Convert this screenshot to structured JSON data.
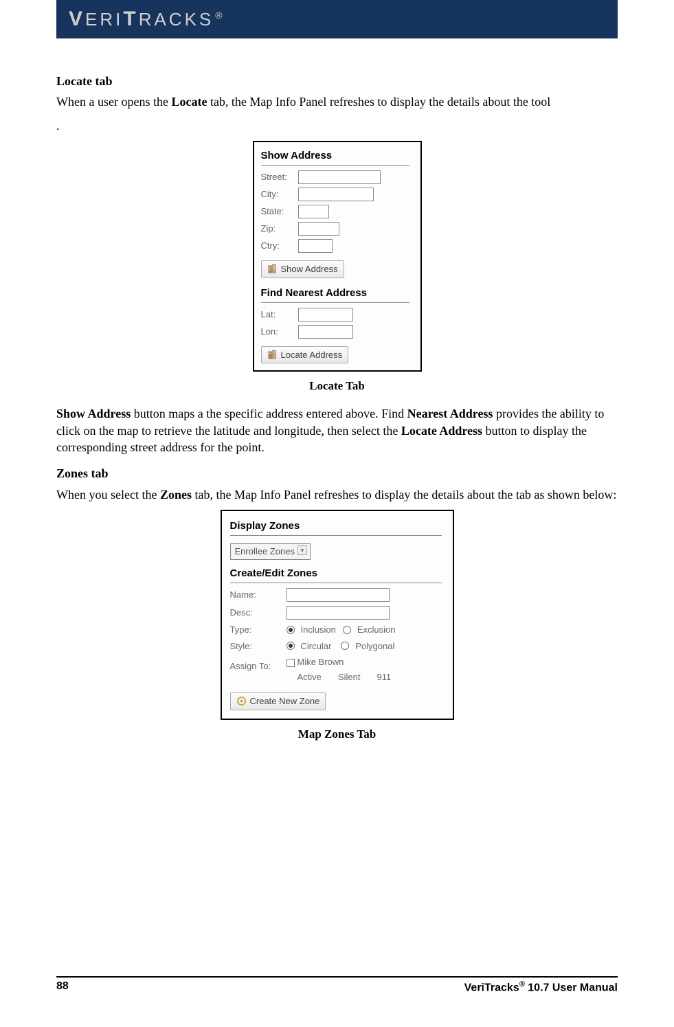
{
  "brand": {
    "name": "VERITRACKS",
    "reg": "®"
  },
  "section1": {
    "heading": "Locate tab",
    "p1_prefix": "When a user opens the ",
    "p1_bold": "Locate",
    "p1_suffix": " tab, the Map Info Panel refreshes to display the details about the tool",
    "dot": "."
  },
  "locate_panel": {
    "sec1_title": "Show Address",
    "street": "Street:",
    "city": "City:",
    "state": "State:",
    "zip": "Zip:",
    "ctry": "Ctry:",
    "show_btn": "Show Address",
    "sec2_title": "Find Nearest Address",
    "lat": "Lat:",
    "lon": "Lon:",
    "locate_btn": "Locate Address"
  },
  "caption1": "Locate Tab",
  "para2": {
    "b1": "Show Address",
    "t1": " button maps a the specific address entered above. Find ",
    "b2": "Nearest Address",
    "t2": " provides the ability to click on the map to retrieve the latitude and longitude, then select the ",
    "b3": "Locate Address",
    "t3": " button to display the corresponding street address for the point."
  },
  "section2": {
    "heading": "Zones tab",
    "p_prefix": "When you select the ",
    "p_bold": "Zones",
    "p_suffix": " tab, the Map Info Panel refreshes to display the details about the tab as shown below:"
  },
  "zones_panel": {
    "sec1_title": "Display Zones",
    "select_value": "Enrollee Zones",
    "sec2_title": "Create/Edit Zones",
    "name": "Name:",
    "desc": "Desc:",
    "type_lbl": "Type:",
    "type_incl": "Inclusion",
    "type_excl": "Exclusion",
    "style_lbl": "Style:",
    "style_circ": "Circular",
    "style_poly": "Polygonal",
    "assign_lbl": "Assign To:",
    "assign_name": "Mike Brown",
    "col_active": "Active",
    "col_silent": "Silent",
    "col_911": "911",
    "create_btn": "Create New Zone"
  },
  "caption2": "Map Zones Tab",
  "footer": {
    "page": "88",
    "prod": "VeriTracks",
    "reg": "®",
    "suffix": " 10.7 User Manual"
  }
}
